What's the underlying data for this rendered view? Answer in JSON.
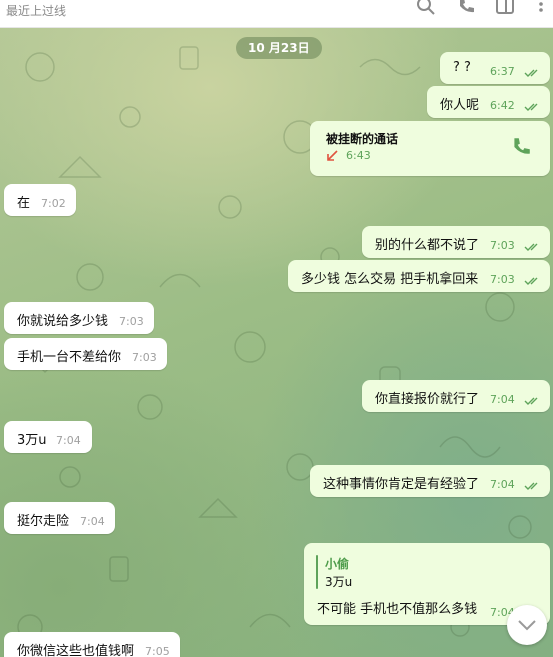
{
  "topbar": {
    "status": "最近上过线"
  },
  "date_label": "10 月23日",
  "messages": [
    {
      "text": "? ?",
      "time": "6:37"
    },
    {
      "text": "你人呢",
      "time": "6:42"
    },
    {
      "call_title": "被挂断的通话",
      "time": "6:43"
    },
    {
      "text": "在",
      "time": "7:02"
    },
    {
      "text": "别的什么都不说了",
      "time": "7:03"
    },
    {
      "text": "多少钱  怎么交易 把手机拿回来",
      "time": "7:03"
    },
    {
      "text": "你就说给多少钱",
      "time": "7:03"
    },
    {
      "text": "手机一台不差给你",
      "time": "7:03"
    },
    {
      "text": "你直接报价就行了",
      "time": "7:04"
    },
    {
      "text": "3万u",
      "time": "7:04"
    },
    {
      "text": "这种事情你肯定是有经验了",
      "time": "7:04"
    },
    {
      "text": "挺尔走险",
      "time": "7:04"
    },
    {
      "quote_name": "小偷",
      "quote_text": "3万u",
      "text": "不可能  手机也不值那么多钱",
      "time": "7:04"
    },
    {
      "text": "你微信这些也值钱啊",
      "time": "7:05"
    }
  ],
  "icons": [
    "search-icon",
    "phone-icon",
    "sidebar-icon",
    "more-icon",
    "double-check-icon",
    "missed-call-icon",
    "chevron-down-icon"
  ],
  "colors": {
    "outgoing_bubble": "#effdde",
    "incoming_bubble": "#ffffff",
    "accent_green": "#5ea35a",
    "missed_red": "#e0533f"
  }
}
